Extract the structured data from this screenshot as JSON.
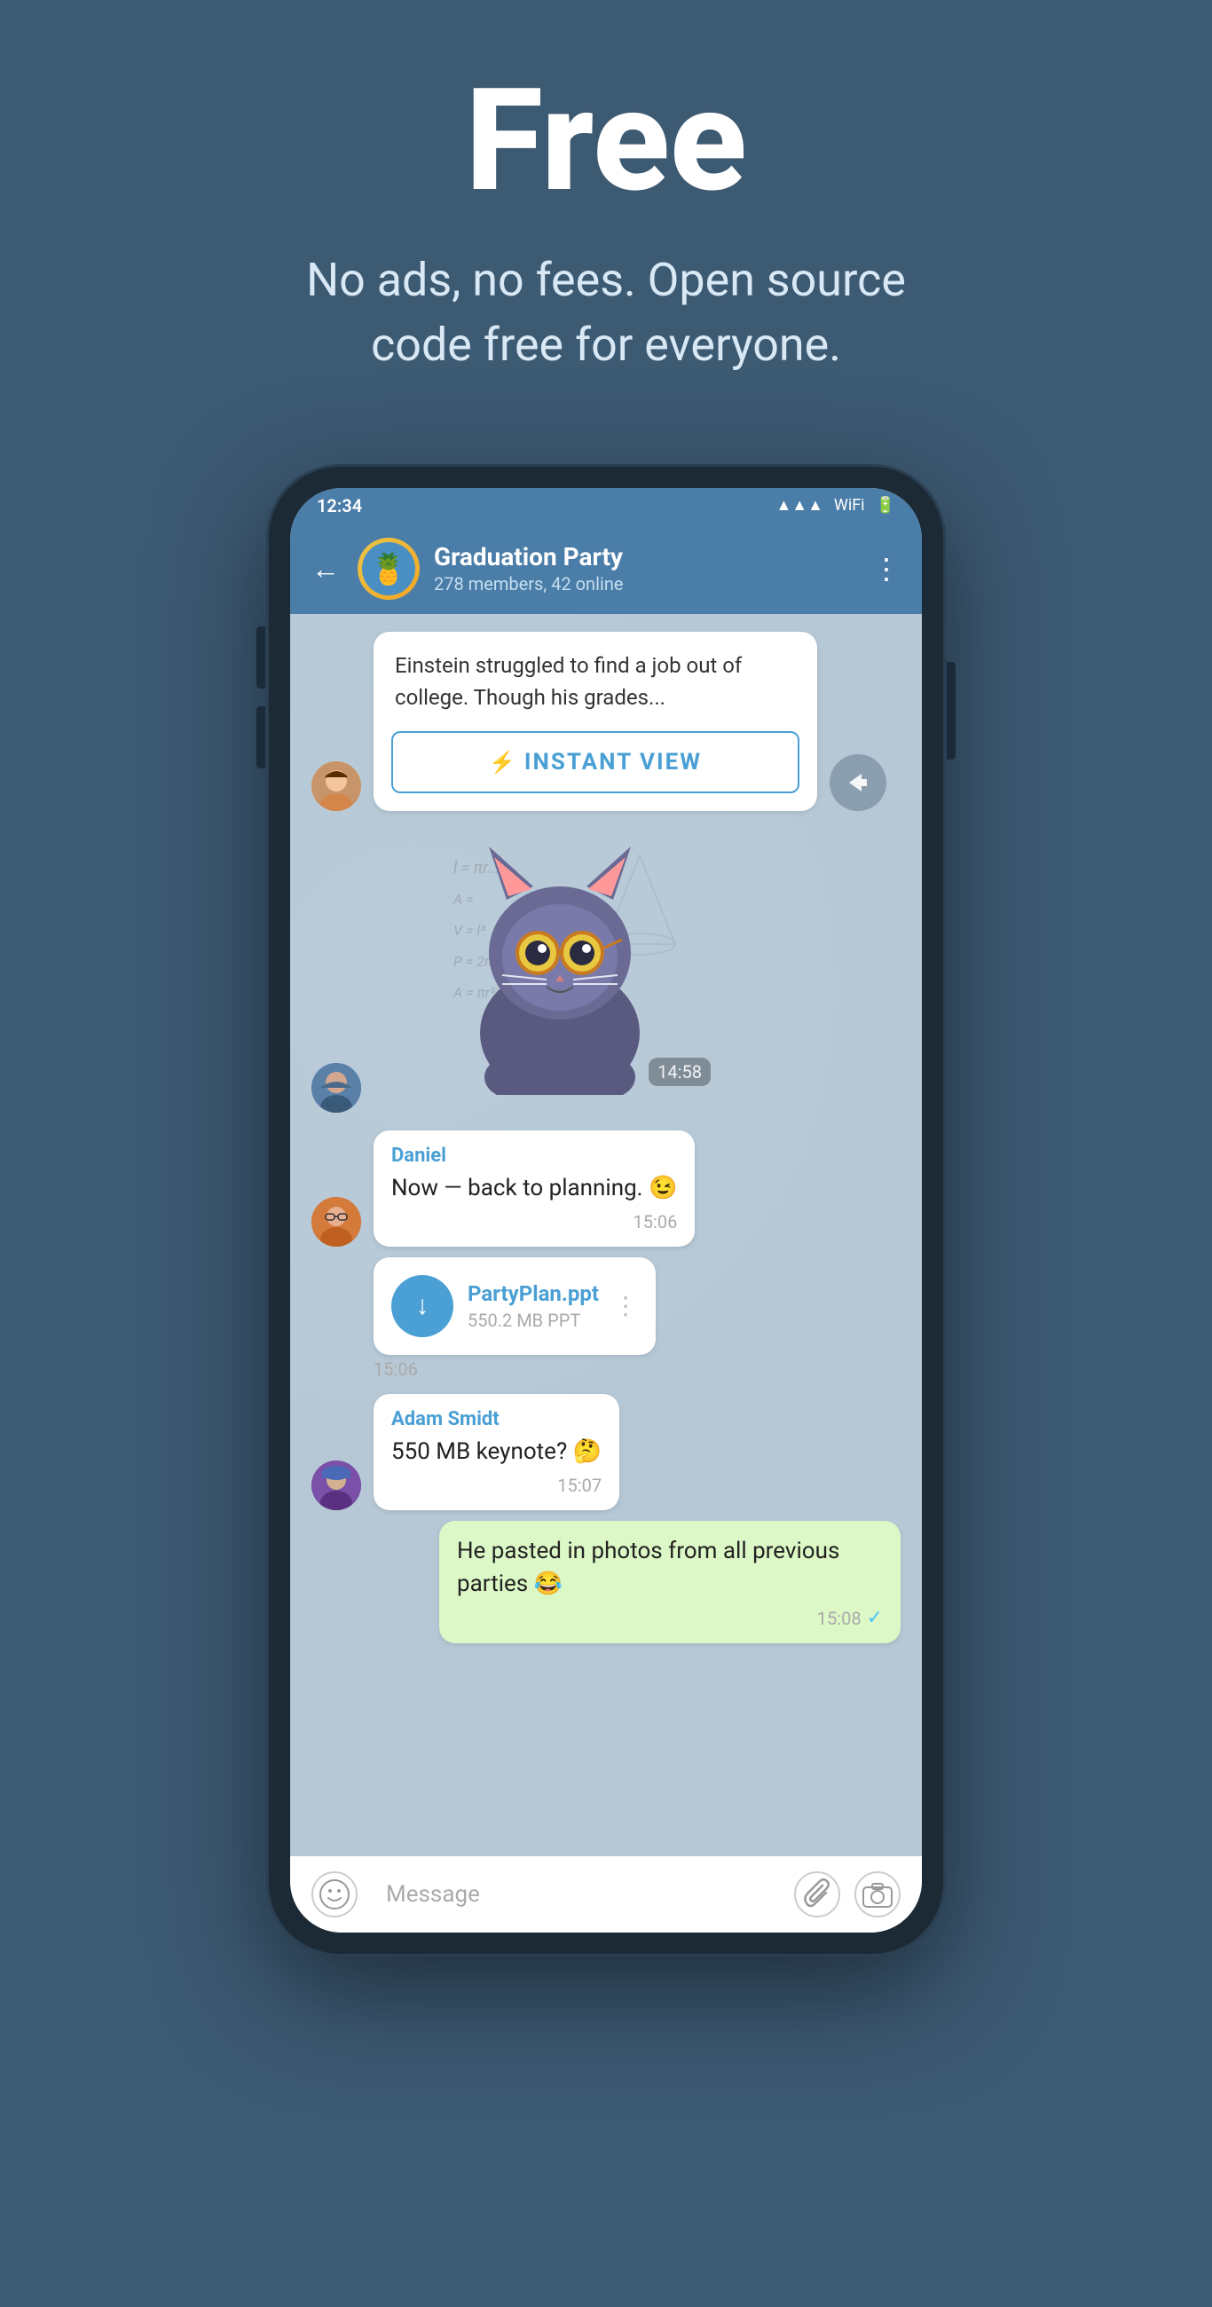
{
  "hero": {
    "title": "Free",
    "subtitle_line1": "No ads, no fees. Open source",
    "subtitle_line2": "code free for everyone."
  },
  "phone": {
    "status": {
      "time": "12:34",
      "icons": [
        "signal",
        "wifi",
        "battery"
      ]
    },
    "header": {
      "group_name": "Graduation Party",
      "members_info": "278 members, 42 online",
      "back_label": "←",
      "more_label": "⋮"
    },
    "messages": [
      {
        "id": "msg1",
        "type": "instant_view",
        "text": "Einstein struggled to find a job out of college. Though his grades...",
        "button_label": "INSTANT VIEW",
        "time": "",
        "avatar": "girl"
      },
      {
        "id": "msg2",
        "type": "sticker",
        "time": "14:58",
        "avatar": "boy1"
      },
      {
        "id": "msg3",
        "type": "text",
        "sender": "Daniel",
        "text": "Now — back to planning. 😉",
        "time": "15:06",
        "avatar": "daniel"
      },
      {
        "id": "msg4",
        "type": "file",
        "filename": "PartyPlan.ppt",
        "filesize": "550.2 MB PPT",
        "time": "15:06",
        "avatar": "daniel"
      },
      {
        "id": "msg5",
        "type": "text",
        "sender": "Adam Smidt",
        "text": "550 MB keynote? 🤔",
        "time": "15:07",
        "avatar": "adam"
      },
      {
        "id": "msg6",
        "type": "text_self",
        "text": "He pasted in photos from all previous parties 😂",
        "time": "15:08",
        "check": "✓"
      }
    ],
    "bottom_bar": {
      "placeholder": "Message",
      "emoji_icon": "😊",
      "attach_icon": "📎",
      "camera_icon": "📷"
    }
  }
}
